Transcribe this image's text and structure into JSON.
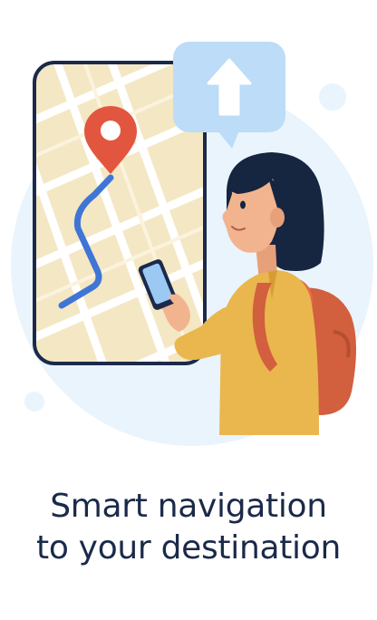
{
  "onboarding": {
    "headline_line1": "Smart navigation",
    "headline_line2": "to your destination",
    "illustration_icons": [
      "map-pin-icon",
      "route-line",
      "arrow-up-icon",
      "smartphone-icon",
      "backpack-icon"
    ]
  },
  "colors": {
    "headline": "#1b2a4a",
    "map_background": "#f4e7c4",
    "map_roads": "#ffffff",
    "route": "#3f76d6",
    "pin": "#e2563f",
    "bubble": "#bcdcf7",
    "backdrop_circle": "#eaf4fc",
    "jacket": "#eab64e",
    "backpack": "#d25f3e",
    "hair": "#162540",
    "skin": "#f2b48e"
  }
}
